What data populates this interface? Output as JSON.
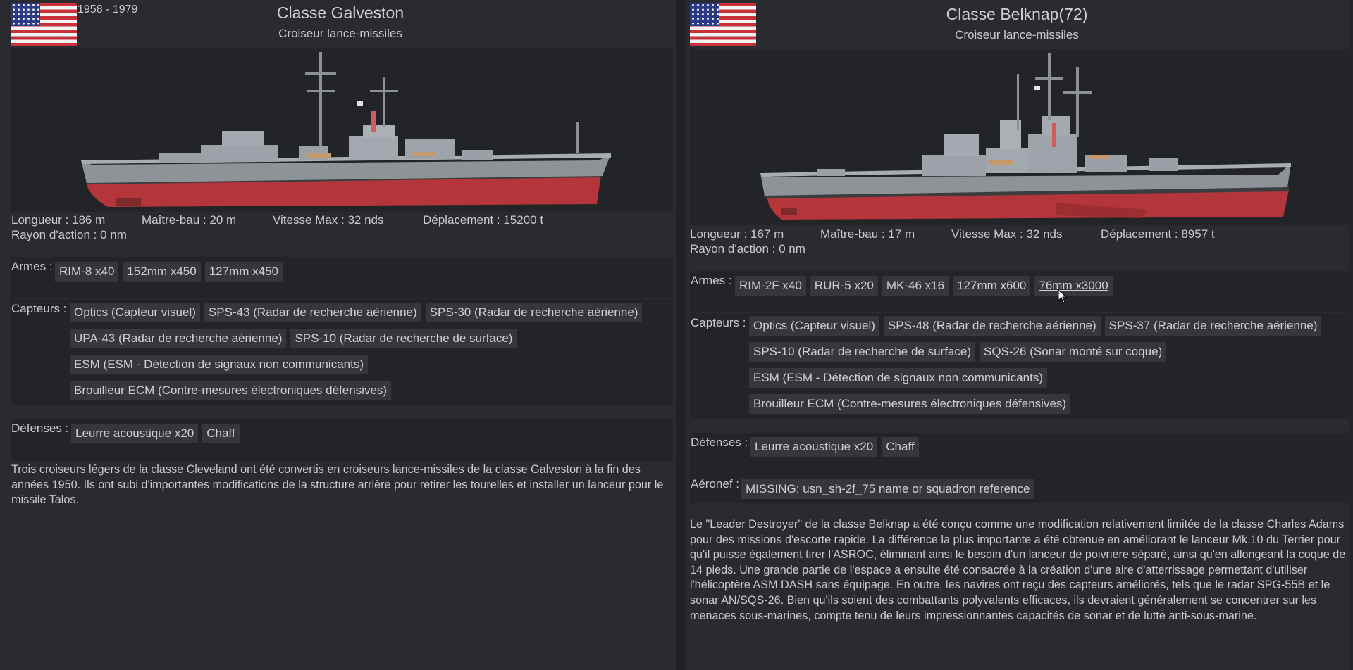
{
  "left": {
    "years": "1958 - 1979",
    "title": "Classe Galveston",
    "subtitle": "Croiseur lance-missiles",
    "flag_icon": "us-flag-icon",
    "stats": {
      "length": "Longueur : 186 m",
      "beam": "Maître-bau : 20 m",
      "speed": "Vitesse Max : 32 nds",
      "displacement": "Déplacement : 15200 t",
      "range": "Rayon d'action : 0 nm"
    },
    "weapons_label": "Armes :",
    "weapons": [
      "RIM-8 x40",
      "152mm x450",
      "127mm x450"
    ],
    "sensors_label": "Capteurs :",
    "sensors": [
      [
        "Optics (Capteur visuel)",
        "SPS-43 (Radar de recherche aérienne)",
        "SPS-30 (Radar de recherche aérienne)"
      ],
      [
        "UPA-43 (Radar de recherche aérienne)",
        "SPS-10 (Radar de recherche de surface)"
      ],
      [
        "ESM (ESM - Détection de signaux non communicants)"
      ],
      [
        "Brouilleur ECM (Contre-mesures électroniques défensives)"
      ]
    ],
    "defenses_label": "Défenses :",
    "defenses": [
      "Leurre acoustique x20",
      "Chaff"
    ],
    "description": "Trois croiseurs légers de la classe Cleveland ont été convertis en croiseurs lance-missiles de la classe Galveston à la fin des années 1950. Ils ont subi d'importantes modifications de la structure arrière pour retirer les tourelles et installer un lanceur pour le missile Talos."
  },
  "right": {
    "title": "Classe Belknap(72)",
    "subtitle": "Croiseur lance-missiles",
    "flag_icon": "us-flag-icon",
    "stats": {
      "length": "Longueur : 167 m",
      "beam": "Maître-bau : 17 m",
      "speed": "Vitesse Max : 32 nds",
      "displacement": "Déplacement : 8957 t",
      "range": "Rayon d'action : 0 nm"
    },
    "weapons_label": "Armes :",
    "weapons": [
      "RIM-2F x40",
      "RUR-5 x20",
      "MK-46 x16",
      "127mm x600",
      "76mm x3000"
    ],
    "sensors_label": "Capteurs :",
    "sensors": [
      [
        "Optics (Capteur visuel)",
        "SPS-48 (Radar de recherche aérienne)",
        "SPS-37 (Radar de recherche aérienne)"
      ],
      [
        "SPS-10 (Radar de recherche de surface)",
        "SQS-26 (Sonar monté sur coque)"
      ],
      [
        "ESM (ESM - Détection de signaux non communicants)"
      ],
      [
        "Brouilleur ECM (Contre-mesures électroniques défensives)"
      ]
    ],
    "defenses_label": "Défenses :",
    "defenses": [
      "Leurre acoustique x20",
      "Chaff"
    ],
    "aircraft_label": "Aéronef :",
    "aircraft": [
      "MISSING: usn_sh-2f_75 name or squadron reference"
    ],
    "description": "Le \"Leader Destroyer\" de la classe Belknap a été conçu comme une modification relativement limitée de la classe Charles Adams pour des missions d'escorte rapide. La différence la plus importante a été obtenue en améliorant le lanceur Mk.10 du Terrier pour qu'il puisse également tirer l'ASROC, éliminant ainsi le besoin d'un lanceur de poivrière séparé, ainsi qu'en allongeant la coque de 14 pieds. Une grande partie de l'espace a ensuite été consacrée à la création d'une aire d'atterrissage permettant d'utiliser l'hélicoptère ASM DASH sans équipage. En outre, les navires ont reçu des capteurs améliorés, tels que le radar SPG-55B et le sonar AN/SQS-26. Bien qu'ils soient des combattants polyvalents efficaces, ils devraient généralement se concentrer sur les menaces sous-marines, compte tenu de leurs impressionnantes capacités de sonar et de lutte anti-sous-marine."
  }
}
